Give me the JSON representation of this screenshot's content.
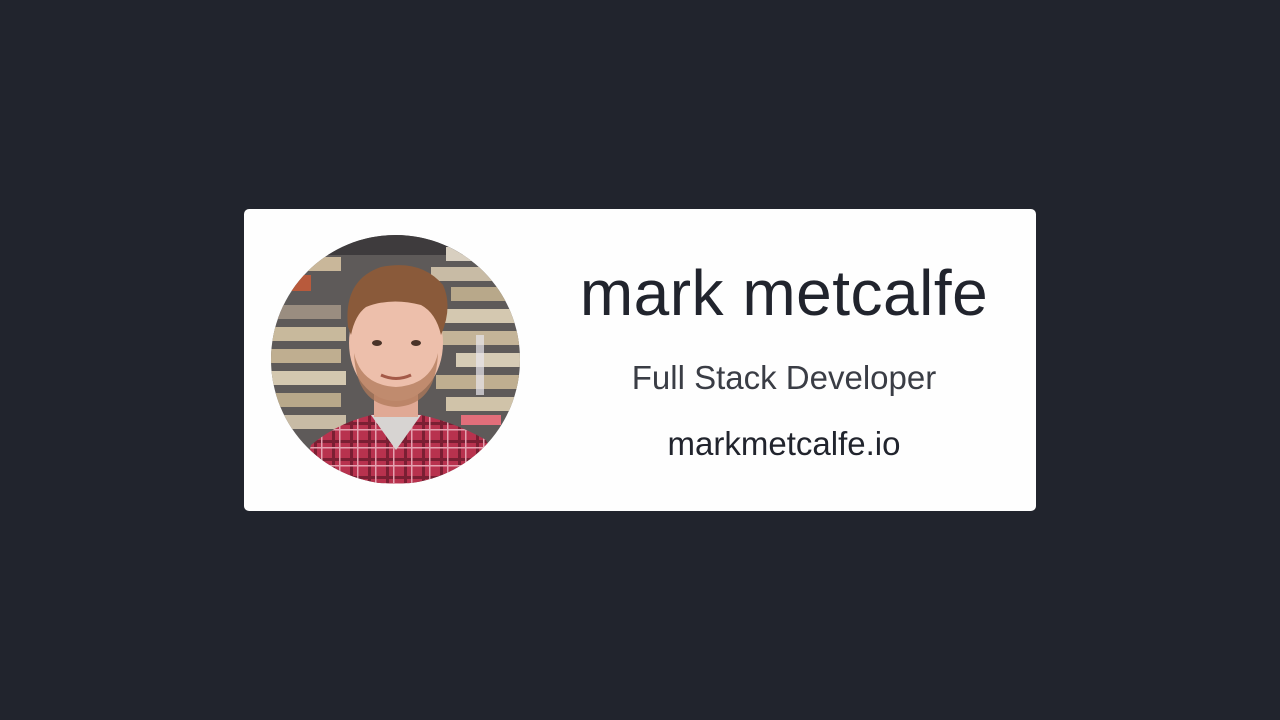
{
  "colors": {
    "background": "#21242d",
    "card": "#fefefe",
    "text": "#21242d"
  },
  "profile": {
    "name": "mark metcalfe",
    "role": "Full Stack Developer",
    "website": "markmetcalfe.io",
    "avatar_icon": "profile-photo"
  }
}
